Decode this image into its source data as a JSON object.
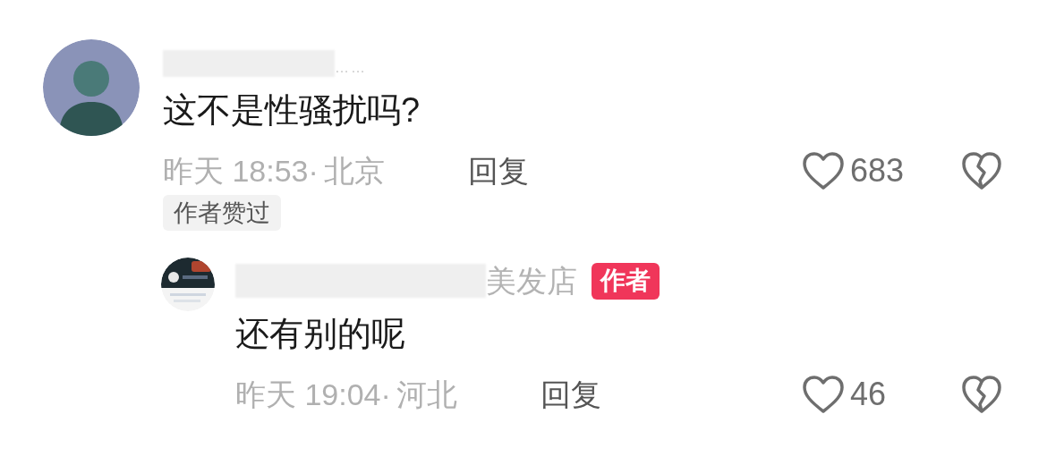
{
  "comments": [
    {
      "author_suffix": "……",
      "text": "这不是性骚扰吗?",
      "time": "昨天 18:53·",
      "location": "北京",
      "reply": "回复",
      "likes": "683",
      "liked_by_author": "作者赞过",
      "kind": "top"
    },
    {
      "author_suffix": "美发店",
      "author_badge": "作者",
      "text": "还有别的呢",
      "time": "昨天 19:04·",
      "location": "河北",
      "reply": "回复",
      "likes": "46",
      "kind": "reply"
    }
  ]
}
